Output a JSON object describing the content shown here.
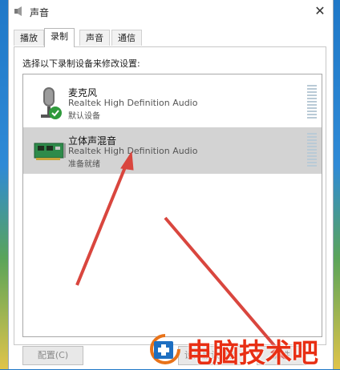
{
  "window": {
    "title": "声音"
  },
  "tabs": [
    {
      "label": "播放",
      "active": false
    },
    {
      "label": "录制",
      "active": true
    },
    {
      "label": "声音",
      "active": false
    },
    {
      "label": "通信",
      "active": false
    }
  ],
  "instruction": "选择以下录制设备来修改设置:",
  "devices": [
    {
      "name": "麦克风",
      "driver": "Realtek High Definition Audio",
      "status": "默认设备",
      "icon": "microphone-icon",
      "default": true,
      "selected": false
    },
    {
      "name": "立体声混音",
      "driver": "Realtek High Definition Audio",
      "status": "准备就绪",
      "icon": "sound-card-icon",
      "default": false,
      "selected": true
    }
  ],
  "buttons": {
    "configure": "配置(C)",
    "set_default": "设为默认设备",
    "properties": "属性"
  },
  "watermark": {
    "text": "电脑技术吧"
  },
  "colors": {
    "selection": "#d3d3d3",
    "annotation_arrow": "#d9463e",
    "watermark": "#e82f14",
    "check_badge": "#2f9a3c"
  }
}
